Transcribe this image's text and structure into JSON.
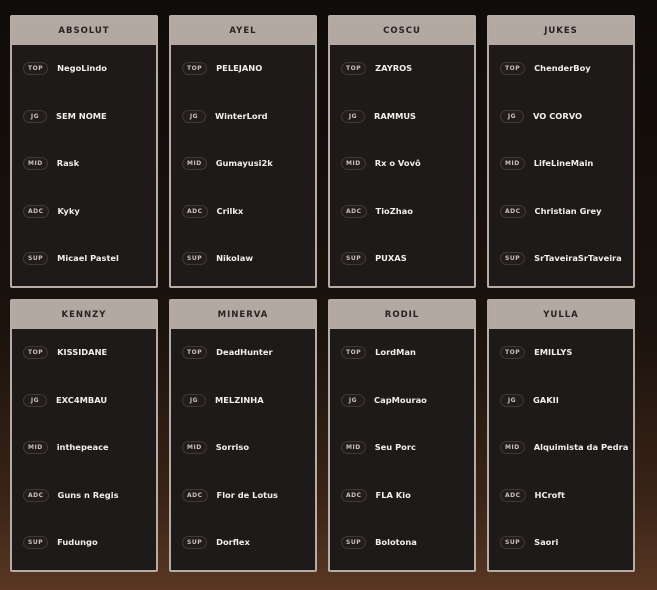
{
  "teams": [
    {
      "name": "ABSOLUT",
      "players": [
        {
          "role": "TOP",
          "name": "NegoLindo"
        },
        {
          "role": "JG",
          "name": "SEM NOME"
        },
        {
          "role": "MID",
          "name": "Rask"
        },
        {
          "role": "ADC",
          "name": "Kyky"
        },
        {
          "role": "SUP",
          "name": "Micael Pastel"
        }
      ]
    },
    {
      "name": "AYEL",
      "players": [
        {
          "role": "TOP",
          "name": "PELEJANO"
        },
        {
          "role": "JG",
          "name": "WinterLord"
        },
        {
          "role": "MID",
          "name": "Gumayusi2k"
        },
        {
          "role": "ADC",
          "name": "Crilkx"
        },
        {
          "role": "SUP",
          "name": "Nikolaw"
        }
      ]
    },
    {
      "name": "COSCU",
      "players": [
        {
          "role": "TOP",
          "name": "ZAYROS"
        },
        {
          "role": "JG",
          "name": "RAMMUS"
        },
        {
          "role": "MID",
          "name": "Rx o Vovô"
        },
        {
          "role": "ADC",
          "name": "TioZhao"
        },
        {
          "role": "SUP",
          "name": "PUXAS"
        }
      ]
    },
    {
      "name": "JUKES",
      "players": [
        {
          "role": "TOP",
          "name": "ChenderBoy"
        },
        {
          "role": "JG",
          "name": "VO CORVO"
        },
        {
          "role": "MID",
          "name": "LifeLineMain"
        },
        {
          "role": "ADC",
          "name": "Christian Grey"
        },
        {
          "role": "SUP",
          "name": "SrTaveiraSrTaveira"
        }
      ]
    },
    {
      "name": "KENNZY",
      "players": [
        {
          "role": "TOP",
          "name": "KISSIDANE"
        },
        {
          "role": "JG",
          "name": "EXC4MBAU"
        },
        {
          "role": "MID",
          "name": "inthepeace"
        },
        {
          "role": "ADC",
          "name": "Guns n Regis"
        },
        {
          "role": "SUP",
          "name": "Fudungo"
        }
      ]
    },
    {
      "name": "MINERVA",
      "players": [
        {
          "role": "TOP",
          "name": "DeadHunter"
        },
        {
          "role": "JG",
          "name": "MELZINHA"
        },
        {
          "role": "MID",
          "name": "Sorriso"
        },
        {
          "role": "ADC",
          "name": "Flor de Lotus"
        },
        {
          "role": "SUP",
          "name": "Dorflex"
        }
      ]
    },
    {
      "name": "RODIL",
      "players": [
        {
          "role": "TOP",
          "name": "LordMan"
        },
        {
          "role": "JG",
          "name": "CapMourao"
        },
        {
          "role": "MID",
          "name": "Seu Porc"
        },
        {
          "role": "ADC",
          "name": "FLA Kio"
        },
        {
          "role": "SUP",
          "name": "Bolotona"
        }
      ]
    },
    {
      "name": "YULLA",
      "players": [
        {
          "role": "TOP",
          "name": "EMILLYS"
        },
        {
          "role": "JG",
          "name": "GAKII"
        },
        {
          "role": "MID",
          "name": "Alquimista da Pedra"
        },
        {
          "role": "ADC",
          "name": "HCroft"
        },
        {
          "role": "SUP",
          "name": "Saori"
        }
      ]
    }
  ]
}
